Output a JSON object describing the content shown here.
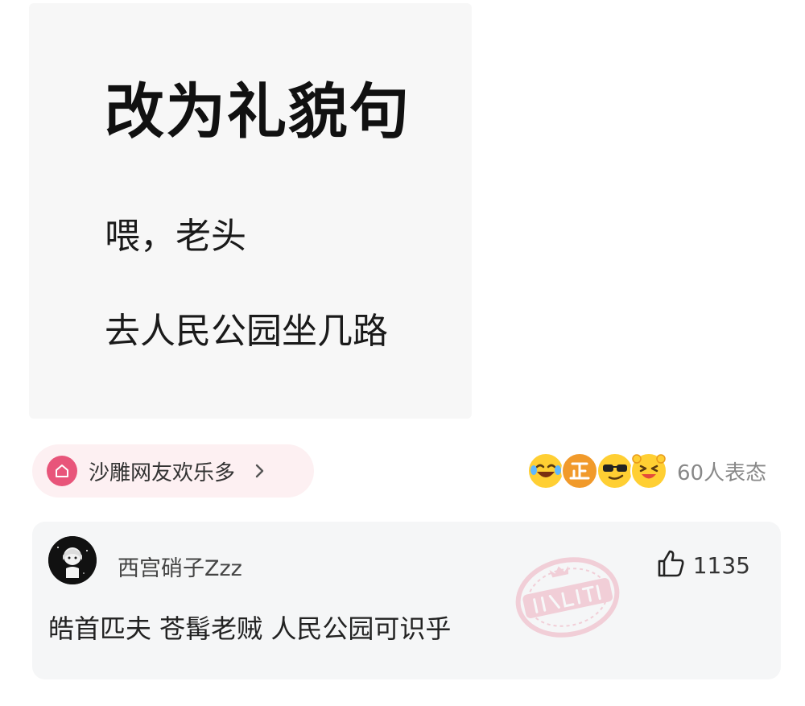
{
  "post_image": {
    "title": "改为礼貌句",
    "line1": "喂，老头",
    "line2": "去人民公园坐几路"
  },
  "topic": {
    "label": "沙雕网友欢乐多",
    "icon": "home-icon",
    "chevron": "chevron-right-icon",
    "accent_color": "#e8557a",
    "background_color": "#fdf0f2"
  },
  "reactions": {
    "emojis": [
      "laughing-tears-emoji",
      "zheng-badge-emoji",
      "sunglasses-emoji",
      "laughing-hands-emoji"
    ],
    "count_label": "60人表态"
  },
  "comment": {
    "username": "西宫硝子Zzz",
    "avatar": "avatar-anime-girl",
    "like_icon": "thumbs-up-icon",
    "like_count": "1135",
    "text": "皓首匹夫 苍髯老贼 人民公园可识乎",
    "badge": "神评-stamp",
    "badge_color": "#e86a86"
  }
}
